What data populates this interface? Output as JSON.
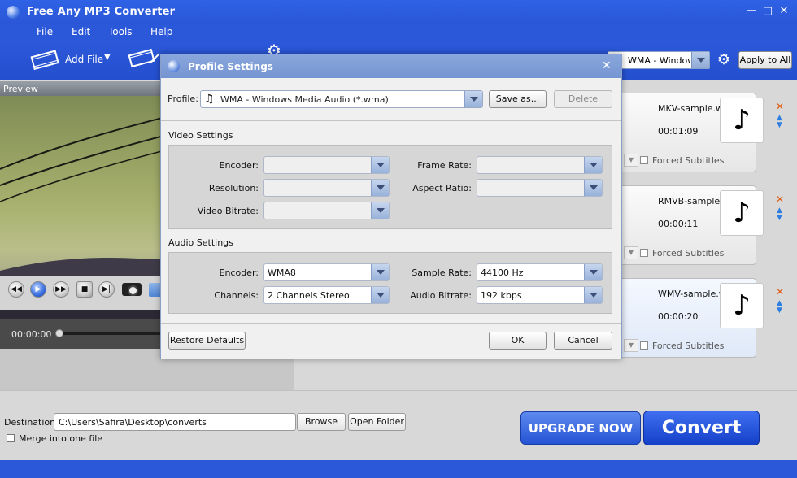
{
  "app": {
    "title": "Free Any MP3 Converter"
  },
  "menu": [
    "File",
    "Edit",
    "Tools",
    "Help"
  ],
  "toolbar": {
    "add_file_label": "Add File",
    "profile_value": "WMA - Windows",
    "apply_all_label": "Apply to All"
  },
  "preview": {
    "title": "Preview",
    "time": "00:00:00"
  },
  "files": [
    {
      "name": "MKV-sample.wma",
      "duration": "00:01:09",
      "forced_label": "Forced Subtitles"
    },
    {
      "name": "RMVB-sample.wma",
      "duration": "00:00:11",
      "forced_label": "Forced Subtitles"
    },
    {
      "name": "WMV-sample.wma",
      "duration": "00:00:20",
      "forced_label": "Forced Subtitles"
    }
  ],
  "bottom": {
    "destination_label": "Destination:",
    "destination_value": "C:\\Users\\Safira\\Desktop\\converts",
    "browse_label": "Browse",
    "open_folder_label": "Open Folder",
    "merge_label": "Merge into one file",
    "upgrade_label": "UPGRADE NOW",
    "convert_label": "Convert"
  },
  "dialog": {
    "title": "Profile Settings",
    "profile_label": "Profile:",
    "profile_value": "WMA - Windows Media Audio (*.wma)",
    "save_as_label": "Save as...",
    "delete_label": "Delete",
    "video_section": "Video Settings",
    "video": {
      "encoder_label": "Encoder:",
      "resolution_label": "Resolution:",
      "bitrate_label": "Video Bitrate:",
      "frame_rate_label": "Frame Rate:",
      "aspect_ratio_label": "Aspect Ratio:"
    },
    "audio_section": "Audio Settings",
    "audio": {
      "encoder_label": "Encoder:",
      "encoder_value": "WMA8",
      "channels_label": "Channels:",
      "channels_value": "2 Channels Stereo",
      "sample_rate_label": "Sample Rate:",
      "sample_rate_value": "44100 Hz",
      "bitrate_label": "Audio Bitrate:",
      "bitrate_value": "192 kbps"
    },
    "restore_label": "Restore Defaults",
    "ok_label": "OK",
    "cancel_label": "Cancel"
  }
}
